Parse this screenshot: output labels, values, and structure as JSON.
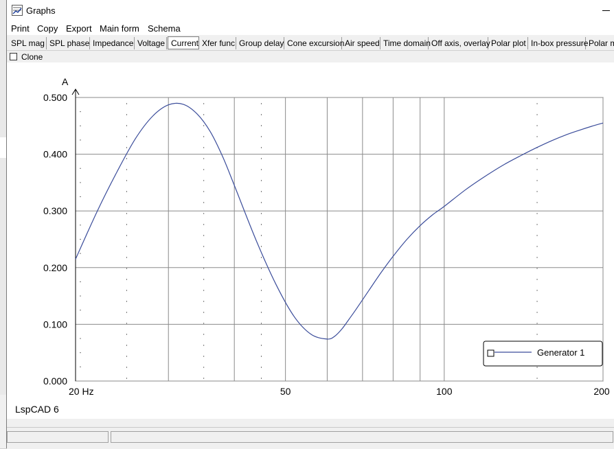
{
  "window": {
    "title": "Graphs"
  },
  "menu": [
    "Print",
    "Copy",
    "Export",
    "Main form",
    "Schema"
  ],
  "tabs": [
    "SPL mag",
    "SPL phase",
    "Impedance",
    "Voltage",
    "Current",
    "Xfer func",
    "Group delay",
    "Cone excursion",
    "Air speed",
    "Time domain",
    "Off axis, overlay",
    "Polar plot",
    "In-box pressure",
    "Polar m"
  ],
  "active_tab": "Current",
  "clone_label": "Clone",
  "watermark": "LspCAD 6",
  "chart_data": {
    "type": "line",
    "ylabel": "A",
    "xlabel": "",
    "xscale": "log",
    "xlim": [
      20,
      200
    ],
    "ylim": [
      0,
      0.5
    ],
    "x_ticks": [
      "20 Hz",
      "50",
      "100",
      "200"
    ],
    "y_ticks": [
      "0.000",
      "0.100",
      "0.200",
      "0.300",
      "0.400",
      "0.500"
    ],
    "legend_position": "bottom-right",
    "grid": true,
    "series": [
      {
        "name": "Generator 1",
        "color": "#3a4c9a",
        "x": [
          20,
          22,
          24,
          26,
          28,
          30,
          32,
          34,
          36,
          38,
          40,
          44,
          48,
          52,
          56,
          60,
          62,
          64,
          66,
          68,
          72,
          76,
          80,
          85,
          90,
          95,
          100,
          110,
          120,
          130,
          140,
          150,
          160,
          170,
          180,
          190,
          200
        ],
        "y": [
          0.215,
          0.3,
          0.37,
          0.428,
          0.467,
          0.487,
          0.488,
          0.471,
          0.44,
          0.396,
          0.345,
          0.248,
          0.17,
          0.113,
          0.082,
          0.074,
          0.079,
          0.092,
          0.109,
          0.126,
          0.16,
          0.192,
          0.22,
          0.25,
          0.274,
          0.293,
          0.308,
          0.338,
          0.362,
          0.382,
          0.398,
          0.412,
          0.424,
          0.434,
          0.442,
          0.449,
          0.455
        ]
      }
    ]
  }
}
